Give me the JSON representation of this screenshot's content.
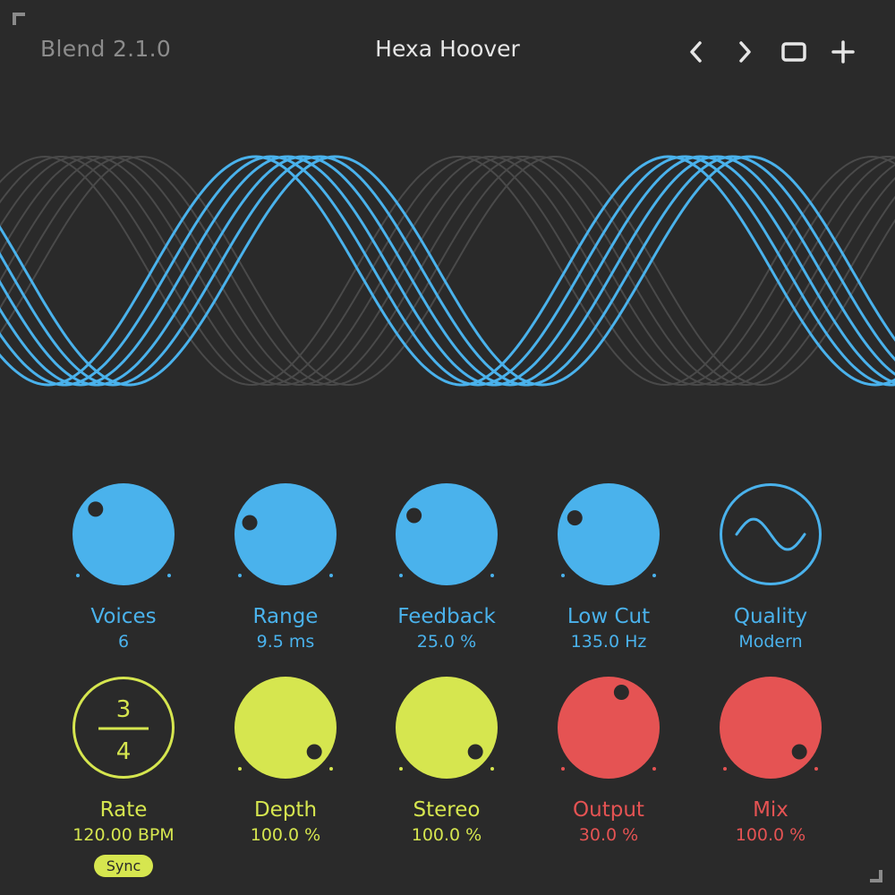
{
  "header": {
    "app_version": "Blend 2.1.0",
    "preset_name": "Hexa Hoover",
    "buttons": [
      {
        "name": "prev-preset-button",
        "icon": "chevron-left-icon"
      },
      {
        "name": "next-preset-button",
        "icon": "chevron-right-icon"
      },
      {
        "name": "window-button",
        "icon": "square-icon"
      },
      {
        "name": "add-button",
        "icon": "plus-icon"
      }
    ]
  },
  "colors": {
    "background": "#2a2a2a",
    "blue": "#4ab2ec",
    "yellow": "#d6e64f",
    "red": "#e55353",
    "wave_inactive": "#4a4a4a"
  },
  "waveform": {
    "active_voices": 6,
    "cycles_visible": 2
  },
  "knobs_row1": [
    {
      "id": "voices",
      "label": "Voices",
      "value": "6",
      "color": "blue"
    },
    {
      "id": "range",
      "label": "Range",
      "value": "9.5 ms",
      "color": "blue"
    },
    {
      "id": "feedback",
      "label": "Feedback",
      "value": "25.0 %",
      "color": "blue"
    },
    {
      "id": "low-cut",
      "label": "Low Cut",
      "value": "135.0 Hz",
      "color": "blue"
    },
    {
      "id": "quality",
      "label": "Quality",
      "value": "Modern",
      "color": "blue",
      "type": "selector",
      "icon": "sine-wave-icon"
    }
  ],
  "knobs_row2": [
    {
      "id": "rate",
      "label": "Rate",
      "value": "120.00 BPM",
      "color": "yellow",
      "type": "fraction",
      "numerator": "3",
      "denominator": "4",
      "button": "Sync"
    },
    {
      "id": "depth",
      "label": "Depth",
      "value": "100.0 %",
      "color": "yellow"
    },
    {
      "id": "stereo",
      "label": "Stereo",
      "value": "100.0 %",
      "color": "yellow"
    },
    {
      "id": "output",
      "label": "Output",
      "value": "30.0 %",
      "color": "red"
    },
    {
      "id": "mix",
      "label": "Mix",
      "value": "100.0 %",
      "color": "red"
    }
  ]
}
